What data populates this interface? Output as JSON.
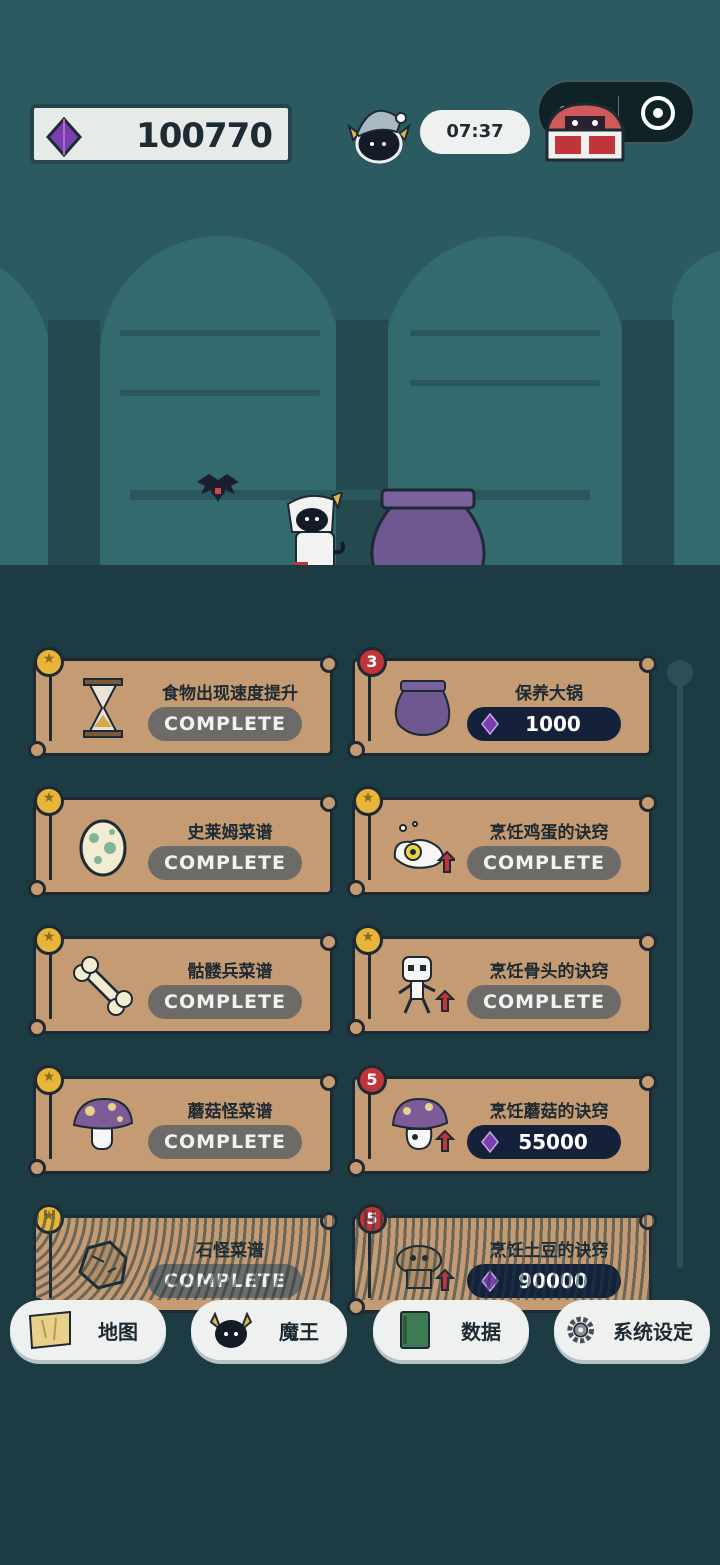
{
  "header": {
    "gem_count": "100770",
    "timer": "07:37"
  },
  "upgrades": [
    {
      "title": "食物出现速度提升",
      "status": "COMPLETE",
      "badge": "star",
      "icon": "hourglass-icon"
    },
    {
      "title": "保养大锅",
      "price": "1000",
      "badge": "3",
      "icon": "cauldron-icon"
    },
    {
      "title": "史莱姆菜谱",
      "status": "COMPLETE",
      "badge": "star",
      "icon": "egg-icon"
    },
    {
      "title": "烹饪鸡蛋的诀窍",
      "status": "COMPLETE",
      "badge": "star",
      "icon": "fried-egg-icon"
    },
    {
      "title": "骷髅兵菜谱",
      "status": "COMPLETE",
      "badge": "star",
      "icon": "bone-icon"
    },
    {
      "title": "烹饪骨头的诀窍",
      "status": "COMPLETE",
      "badge": "star",
      "icon": "skeleton-icon"
    },
    {
      "title": "蘑菇怪菜谱",
      "status": "COMPLETE",
      "badge": "star",
      "icon": "mushroom-icon"
    },
    {
      "title": "烹饪蘑菇的诀窍",
      "price": "55000",
      "badge": "5",
      "icon": "mushroom-monster-icon"
    },
    {
      "title": "石怪菜谱",
      "status": "COMPLETE",
      "badge": "star",
      "icon": "rock-icon"
    },
    {
      "title": "烹饪土豆的诀窍",
      "price": "90000",
      "badge": "5",
      "icon": "golem-icon"
    }
  ],
  "nav": {
    "map": "地图",
    "demon_king": "魔王",
    "data": "数据",
    "settings": "系统设定"
  },
  "colors": {
    "card": "#c49b72",
    "complete_button": "#6c6b68",
    "price_button": "#15213a",
    "gem": "#7b3fb0",
    "badge_red": "#c0353a",
    "badge_star": "#e8b43a"
  }
}
